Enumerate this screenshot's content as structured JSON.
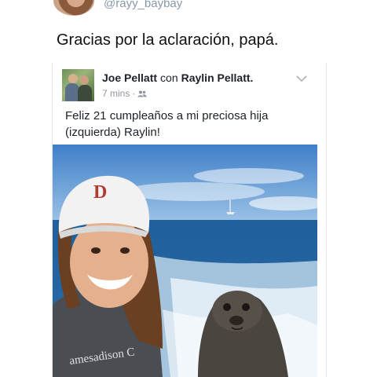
{
  "tweet": {
    "handle": "@rayy_baybay",
    "text": "Gracias por la aclaración, papá."
  },
  "post": {
    "author": "Joe Pellatt",
    "with_word": "con",
    "tagged": "Raylin Pellatt.",
    "time": "7 mins",
    "time_separator": "·",
    "audience_icon": "friends-icon",
    "menu_icon": "chevron-down-icon",
    "text_line1": "Feliz 21 cumpleaños a mi preciosa hija",
    "text_line2": "(izquierda) Raylin!",
    "cap_logo": "D",
    "shirt_text": "amesadison C"
  },
  "colors": {
    "handle": "#8899a6",
    "meta": "#90949c",
    "text": "#1d2129"
  }
}
